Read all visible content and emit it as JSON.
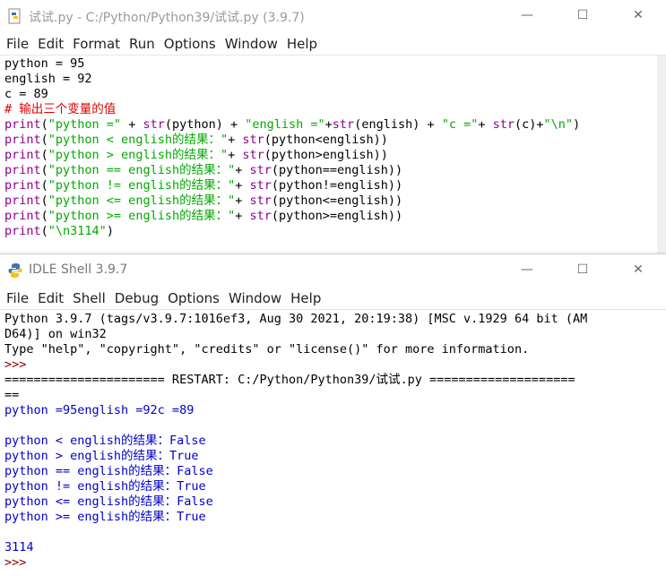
{
  "editor": {
    "title": "试试.py - C:/Python/Python39/试试.py (3.9.7)",
    "menu": [
      "File",
      "Edit",
      "Format",
      "Run",
      "Options",
      "Window",
      "Help"
    ],
    "lines": [
      [
        {
          "t": "python = 95",
          "c": "tx"
        }
      ],
      [
        {
          "t": "english = 92",
          "c": "tx"
        }
      ],
      [
        {
          "t": "c = 89",
          "c": "tx"
        }
      ],
      [
        {
          "t": "# 输出三个变量的值",
          "c": "cm"
        }
      ],
      [
        {
          "t": "print",
          "c": "kw"
        },
        {
          "t": "(",
          "c": "tx"
        },
        {
          "t": "\"python =\"",
          "c": "st"
        },
        {
          "t": " + ",
          "c": "tx"
        },
        {
          "t": "str",
          "c": "kw"
        },
        {
          "t": "(python) + ",
          "c": "tx"
        },
        {
          "t": "\"english =\"",
          "c": "st"
        },
        {
          "t": "+",
          "c": "tx"
        },
        {
          "t": "str",
          "c": "kw"
        },
        {
          "t": "(english) + ",
          "c": "tx"
        },
        {
          "t": "\"c =\"",
          "c": "st"
        },
        {
          "t": "+ ",
          "c": "tx"
        },
        {
          "t": "str",
          "c": "kw"
        },
        {
          "t": "(c)+",
          "c": "tx"
        },
        {
          "t": "\"\\n\"",
          "c": "st"
        },
        {
          "t": ")",
          "c": "tx"
        }
      ],
      [
        {
          "t": "print",
          "c": "kw"
        },
        {
          "t": "(",
          "c": "tx"
        },
        {
          "t": "\"python < english的结果：\"",
          "c": "st"
        },
        {
          "t": "+ ",
          "c": "tx"
        },
        {
          "t": "str",
          "c": "kw"
        },
        {
          "t": "(python<english))",
          "c": "tx"
        }
      ],
      [
        {
          "t": "print",
          "c": "kw"
        },
        {
          "t": "(",
          "c": "tx"
        },
        {
          "t": "\"python > english的结果：\"",
          "c": "st"
        },
        {
          "t": "+ ",
          "c": "tx"
        },
        {
          "t": "str",
          "c": "kw"
        },
        {
          "t": "(python>english))",
          "c": "tx"
        }
      ],
      [
        {
          "t": "print",
          "c": "kw"
        },
        {
          "t": "(",
          "c": "tx"
        },
        {
          "t": "\"python == english的结果：\"",
          "c": "st"
        },
        {
          "t": "+ ",
          "c": "tx"
        },
        {
          "t": "str",
          "c": "kw"
        },
        {
          "t": "(python==english))",
          "c": "tx"
        }
      ],
      [
        {
          "t": "print",
          "c": "kw"
        },
        {
          "t": "(",
          "c": "tx"
        },
        {
          "t": "\"python != english的结果：\"",
          "c": "st"
        },
        {
          "t": "+ ",
          "c": "tx"
        },
        {
          "t": "str",
          "c": "kw"
        },
        {
          "t": "(python!=english))",
          "c": "tx"
        }
      ],
      [
        {
          "t": "print",
          "c": "kw"
        },
        {
          "t": "(",
          "c": "tx"
        },
        {
          "t": "\"python <= english的结果：\"",
          "c": "st"
        },
        {
          "t": "+ ",
          "c": "tx"
        },
        {
          "t": "str",
          "c": "kw"
        },
        {
          "t": "(python<=english))",
          "c": "tx"
        }
      ],
      [
        {
          "t": "print",
          "c": "kw"
        },
        {
          "t": "(",
          "c": "tx"
        },
        {
          "t": "\"python >= english的结果：\"",
          "c": "st"
        },
        {
          "t": "+ ",
          "c": "tx"
        },
        {
          "t": "str",
          "c": "kw"
        },
        {
          "t": "(python>=english))",
          "c": "tx"
        }
      ],
      [
        {
          "t": "print",
          "c": "kw"
        },
        {
          "t": "(",
          "c": "tx"
        },
        {
          "t": "\"\\n3114\"",
          "c": "st"
        },
        {
          "t": ")",
          "c": "tx"
        }
      ]
    ]
  },
  "shell": {
    "title": "IDLE Shell 3.9.7",
    "menu": [
      "File",
      "Edit",
      "Shell",
      "Debug",
      "Options",
      "Window",
      "Help"
    ],
    "lines": [
      [
        {
          "t": "Python 3.9.7 (tags/v3.9.7:1016ef3, Aug 30 2021, 20:19:38) [MSC v.1929 64 bit (AM",
          "c": "tx"
        }
      ],
      [
        {
          "t": "D64)] on win32",
          "c": "tx"
        }
      ],
      [
        {
          "t": "Type \"help\", \"copyright\", \"credits\" or \"license()\" for more information.",
          "c": "tx"
        }
      ],
      [
        {
          "t": ">>> ",
          "c": "pr"
        }
      ],
      [
        {
          "t": "====================== RESTART: C:/Python/Python39/试试.py ====================",
          "c": "tx"
        }
      ],
      [
        {
          "t": "==",
          "c": "tx"
        }
      ],
      [
        {
          "t": "python =95english =92c =89",
          "c": "bl"
        }
      ],
      [
        {
          "t": "",
          "c": "bl"
        }
      ],
      [
        {
          "t": "python < english的结果：False",
          "c": "bl"
        }
      ],
      [
        {
          "t": "python > english的结果：True",
          "c": "bl"
        }
      ],
      [
        {
          "t": "python == english的结果：False",
          "c": "bl"
        }
      ],
      [
        {
          "t": "python != english的结果：True",
          "c": "bl"
        }
      ],
      [
        {
          "t": "python <= english的结果：False",
          "c": "bl"
        }
      ],
      [
        {
          "t": "python >= english的结果：True",
          "c": "bl"
        }
      ],
      [
        {
          "t": "",
          "c": "bl"
        }
      ],
      [
        {
          "t": "3114",
          "c": "bl"
        }
      ],
      [
        {
          "t": ">>> ",
          "c": "pr"
        }
      ]
    ]
  },
  "window_buttons": {
    "minimize": "—",
    "maximize": "☐",
    "close": "✕"
  },
  "colors": {
    "keyword": "#900090",
    "string": "#00aa00",
    "comment": "#dd0000",
    "output": "#0000cc",
    "prompt": "#8b0000"
  }
}
